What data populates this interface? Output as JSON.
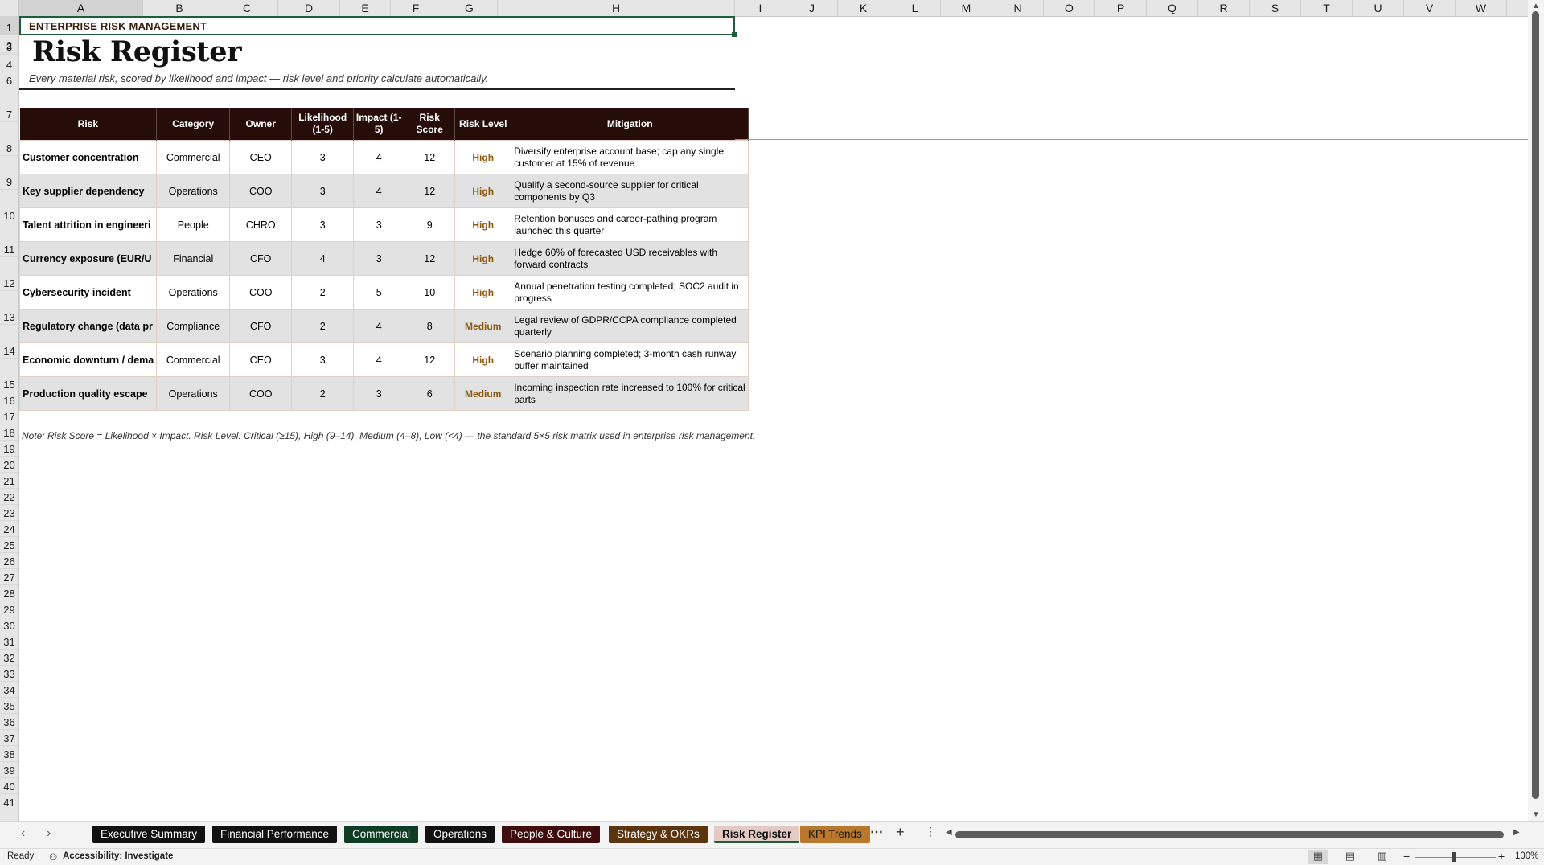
{
  "sheet": {
    "columns": [
      "A",
      "B",
      "C",
      "D",
      "E",
      "F",
      "G",
      "H",
      "I",
      "J",
      "K",
      "L",
      "M",
      "N",
      "O",
      "P",
      "Q",
      "R",
      "S",
      "T",
      "U",
      "V",
      "W"
    ],
    "rows": [
      "1",
      "2",
      "3",
      "4",
      "6",
      "7",
      "8",
      "9",
      "10",
      "11",
      "12",
      "13",
      "14",
      "15",
      "16",
      "17",
      "18",
      "19",
      "20",
      "21",
      "22",
      "23",
      "24",
      "25",
      "26",
      "27",
      "28",
      "29",
      "30",
      "31",
      "32",
      "33",
      "34",
      "35",
      "36",
      "37",
      "38",
      "39",
      "40",
      "41"
    ],
    "header_label": "ENTERPRISE RISK MANAGEMENT",
    "title": "Risk Register",
    "subtitle": "Every material risk, scored by likelihood and impact — risk level and priority calculate automatically.",
    "table": {
      "headers": [
        "Risk",
        "Category",
        "Owner",
        "Likelihood (1-5)",
        "Impact (1-5)",
        "Risk Score",
        "Risk Level",
        "Mitigation"
      ],
      "rows": [
        {
          "risk": "Customer concentration",
          "category": "Commercial",
          "owner": "CEO",
          "likelihood": "3",
          "impact": "4",
          "score": "12",
          "level": "High",
          "mitigation": "Diversify enterprise account base; cap any single customer at 15% of revenue"
        },
        {
          "risk": "Key supplier dependency",
          "category": "Operations",
          "owner": "COO",
          "likelihood": "3",
          "impact": "4",
          "score": "12",
          "level": "High",
          "mitigation": "Qualify a second-source supplier for critical components by Q3"
        },
        {
          "risk": "Talent attrition in engineeri",
          "category": "People",
          "owner": "CHRO",
          "likelihood": "3",
          "impact": "3",
          "score": "9",
          "level": "High",
          "mitigation": "Retention bonuses and career-pathing program launched this quarter"
        },
        {
          "risk": "Currency exposure (EUR/U",
          "category": "Financial",
          "owner": "CFO",
          "likelihood": "4",
          "impact": "3",
          "score": "12",
          "level": "High",
          "mitigation": "Hedge 60% of forecasted USD receivables with forward contracts"
        },
        {
          "risk": "Cybersecurity incident",
          "category": "Operations",
          "owner": "COO",
          "likelihood": "2",
          "impact": "5",
          "score": "10",
          "level": "High",
          "mitigation": "Annual penetration testing completed; SOC2 audit in progress"
        },
        {
          "risk": "Regulatory change (data pr",
          "category": "Compliance",
          "owner": "CFO",
          "likelihood": "2",
          "impact": "4",
          "score": "8",
          "level": "Medium",
          "mitigation": "Legal review of GDPR/CCPA compliance completed quarterly"
        },
        {
          "risk": "Economic downturn / dema",
          "category": "Commercial",
          "owner": "CEO",
          "likelihood": "3",
          "impact": "4",
          "score": "12",
          "level": "High",
          "mitigation": "Scenario planning completed; 3-month cash runway buffer maintained"
        },
        {
          "risk": "Production quality escape",
          "category": "Operations",
          "owner": "COO",
          "likelihood": "2",
          "impact": "3",
          "score": "6",
          "level": "Medium",
          "mitigation": "Incoming inspection rate increased to 100% for critical parts"
        }
      ]
    },
    "note": "Note: Risk Score = Likelihood × Impact. Risk Level: Critical (≥15), High (9–14), Medium (4–8), Low (<4) — the standard 5×5 risk matrix used in enterprise risk management."
  },
  "tabs": [
    {
      "label": "Executive Summary",
      "bg": "#111111",
      "fg": "#ffffff"
    },
    {
      "label": "Financial Performance",
      "bg": "#111111",
      "fg": "#ffffff"
    },
    {
      "label": "Commercial",
      "bg": "#0f3d24",
      "fg": "#ffffff"
    },
    {
      "label": "Operations",
      "bg": "#111111",
      "fg": "#ffffff"
    },
    {
      "label": "People & Culture",
      "bg": "#3f0d0d",
      "fg": "#ffffff"
    },
    {
      "label": "Strategy & OKRs",
      "bg": "#5a3510",
      "fg": "#ffffff"
    },
    {
      "label": "Risk Register",
      "bg": "#e4c9c4",
      "fg": "#111111",
      "active": true
    },
    {
      "label": "KPI Trends",
      "bg": "#b8782e",
      "fg": "#111111"
    }
  ],
  "status": {
    "ready": "Ready",
    "accessibility": "Accessibility: Investigate",
    "zoom": "100%"
  },
  "colors": {
    "header_bg": "#260d0a",
    "level_text": "#8b5a10",
    "selection": "#1e5e3b"
  }
}
